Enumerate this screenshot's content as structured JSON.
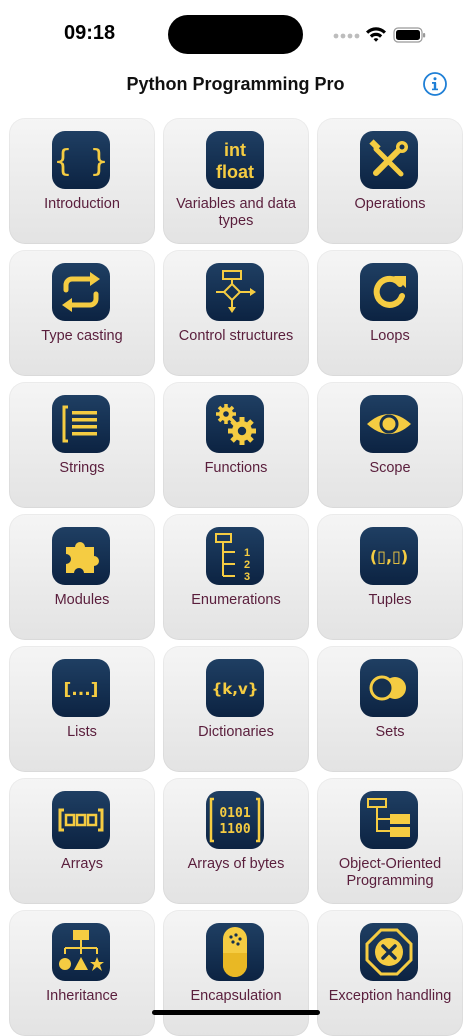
{
  "status": {
    "time": "09:18"
  },
  "header": {
    "title": "Python Programming Pro"
  },
  "colors": {
    "accent": "#1e7fd6",
    "icon_fg": "#f5cc42",
    "icon_bg": "#15304f",
    "label": "#5a1e3c"
  },
  "tiles": [
    {
      "label": "Introduction",
      "icon": "braces-icon"
    },
    {
      "label": "Variables and data types",
      "icon": "int-float-icon",
      "icon_text": [
        "int",
        "float"
      ]
    },
    {
      "label": "Operations",
      "icon": "tools-icon"
    },
    {
      "label": "Type casting",
      "icon": "convert-arrows-icon"
    },
    {
      "label": "Control structures",
      "icon": "flowchart-icon"
    },
    {
      "label": "Loops",
      "icon": "loop-arrow-icon"
    },
    {
      "label": "Strings",
      "icon": "text-lines-icon"
    },
    {
      "label": "Functions",
      "icon": "gears-icon"
    },
    {
      "label": "Scope",
      "icon": "eye-icon"
    },
    {
      "label": "Modules",
      "icon": "puzzle-icon"
    },
    {
      "label": "Enumerations",
      "icon": "numbered-tree-icon",
      "icon_text": [
        "1",
        "2",
        "3"
      ]
    },
    {
      "label": "Tuples",
      "icon": "tuple-icon",
      "icon_text": [
        "(▯,▯)"
      ]
    },
    {
      "label": "Lists",
      "icon": "list-brackets-icon",
      "icon_text": [
        "[...]"
      ]
    },
    {
      "label": "Dictionaries",
      "icon": "key-value-icon",
      "icon_text": [
        "{k,v}"
      ]
    },
    {
      "label": "Sets",
      "icon": "circles-icon"
    },
    {
      "label": "Arrays",
      "icon": "array-icon"
    },
    {
      "label": "Arrays of bytes",
      "icon": "bytes-icon",
      "icon_text": [
        "0101",
        "1100"
      ]
    },
    {
      "label": "Object-Oriented Programming",
      "icon": "class-tree-icon"
    },
    {
      "label": "Inheritance",
      "icon": "hierarchy-icon"
    },
    {
      "label": "Encapsulation",
      "icon": "capsule-icon"
    },
    {
      "label": "Exception handling",
      "icon": "error-x-icon"
    }
  ]
}
